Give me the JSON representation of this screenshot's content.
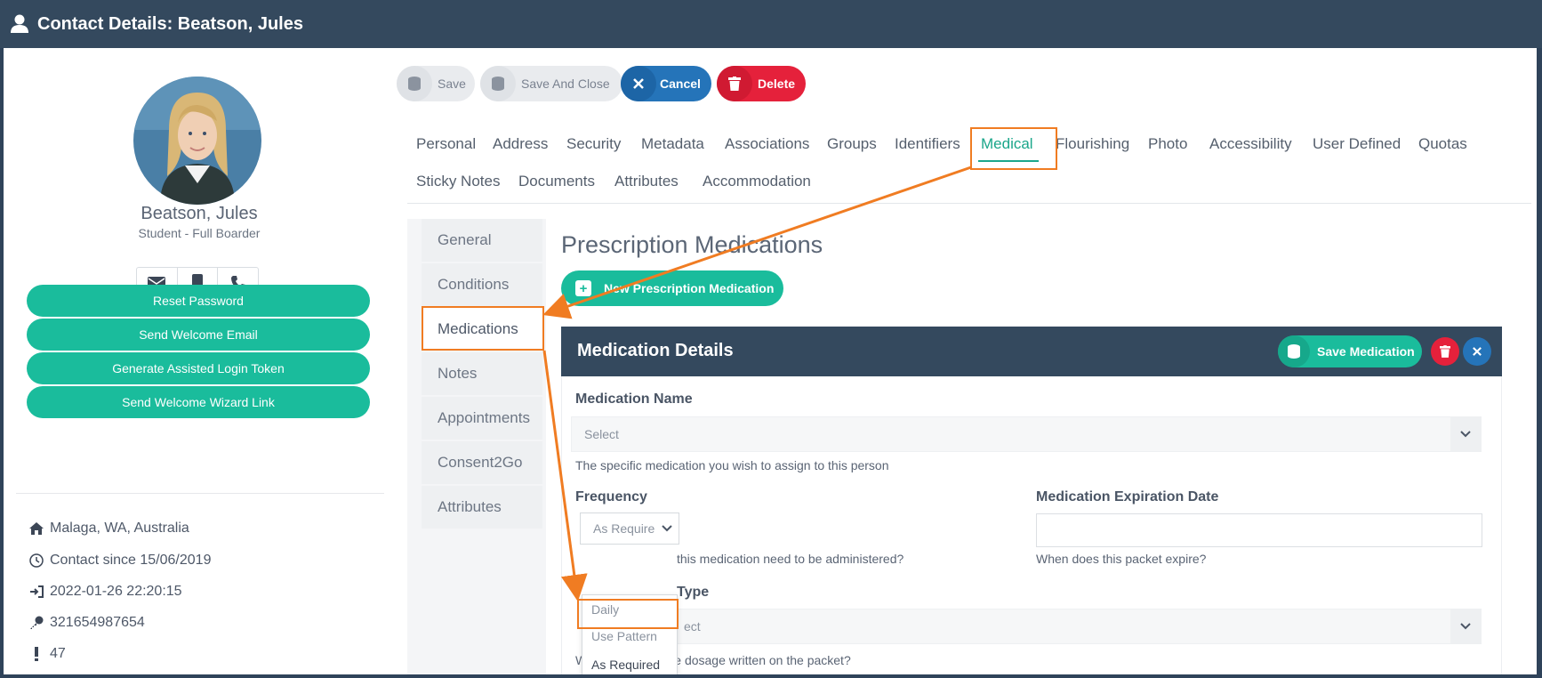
{
  "window": {
    "title": "Contact Details: Beatson, Jules"
  },
  "profile": {
    "name": "Beatson, Jules",
    "role": "Student - Full Boarder",
    "actions": [
      "Reset Password",
      "Send Welcome Email",
      "Generate Assisted Login Token",
      "Send Welcome Wizard Link"
    ],
    "info": {
      "location": "Malaga, WA, Australia",
      "contact_since": "Contact since 15/06/2019",
      "last_login": "2022-01-26 22:20:15",
      "key": "321654987654",
      "alerts": "47"
    }
  },
  "toolbar": {
    "save": "Save",
    "save_close": "Save And Close",
    "cancel": "Cancel",
    "delete": "Delete"
  },
  "tabs": {
    "row1": [
      "Personal",
      "Address",
      "Security",
      "Metadata",
      "Associations",
      "Groups",
      "Identifiers",
      "Medical",
      "Flourishing",
      "Photo",
      "Accessibility",
      "User Defined",
      "Quotas"
    ],
    "row2": [
      "Sticky Notes",
      "Documents",
      "Attributes",
      "Accommodation"
    ],
    "active": "Medical"
  },
  "sidenav": {
    "items": [
      "General",
      "Conditions",
      "Medications",
      "Notes",
      "Appointments",
      "Consent2Go",
      "Attributes"
    ],
    "active": "Medications"
  },
  "main": {
    "heading": "Prescription Medications",
    "new_button": "New Prescription Medication",
    "panel": {
      "title": "Medication Details",
      "save_button": "Save Medication",
      "medication_name": {
        "label": "Medication Name",
        "placeholder": "Select",
        "help": "The specific medication you wish to assign to this person"
      },
      "frequency": {
        "label": "Frequency",
        "value": "As Require",
        "help": "this medication need to be administered?",
        "options": [
          "Daily",
          "Use Pattern",
          "As Required"
        ],
        "selected": "As Required"
      },
      "expiration": {
        "label": "Medication Expiration Date",
        "help": "When does this packet expire?"
      },
      "dosage": {
        "label_tail": "Type",
        "placeholder_tail": "ect",
        "help": "What is the precise dosage written on the packet?"
      }
    }
  },
  "colors": {
    "header": "#34495e",
    "accent": "#1abc9c",
    "blue": "#2574b9",
    "red": "#e5213b",
    "highlight": "#f07c22"
  }
}
